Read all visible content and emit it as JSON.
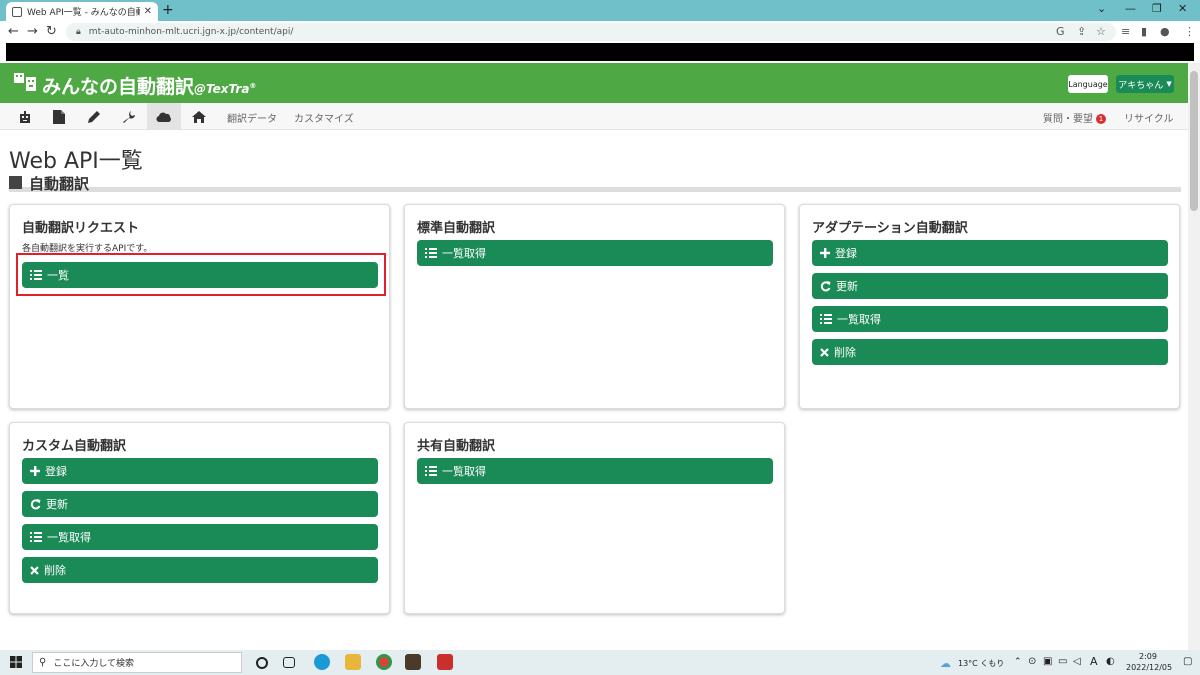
{
  "browser": {
    "tab_title": "Web API一覧 - みんなの自動翻訳@TexTra",
    "url": "mt-auto-minhon-mlt.ucri.jgn-x.jp/content/api/"
  },
  "header": {
    "logo_main": "みんなの自動翻訳",
    "logo_sub": "@TexTra",
    "logo_reg": "®",
    "language_label": "Language",
    "user_label": "アキちゃん"
  },
  "nav": {
    "link_data": "翻訳データ",
    "link_customize": "カスタマイズ",
    "link_requests": "質問・要望",
    "requests_badge": "1",
    "link_recycle": "リサイクル"
  },
  "page": {
    "title": "Web API一覧",
    "section_title": "自動翻訳"
  },
  "cards": {
    "request": {
      "title": "自動翻訳リクエスト",
      "desc": "各自動翻訳を実行するAPIです。",
      "btn_list": "一覧"
    },
    "standard": {
      "title": "標準自動翻訳",
      "btn_list": "一覧取得"
    },
    "adaptation": {
      "title": "アダプテーション自動翻訳",
      "btn_register": "登録",
      "btn_update": "更新",
      "btn_list": "一覧取得",
      "btn_delete": "削除"
    },
    "custom": {
      "title": "カスタム自動翻訳",
      "btn_register": "登録",
      "btn_update": "更新",
      "btn_list": "一覧取得",
      "btn_delete": "削除"
    },
    "shared": {
      "title": "共有自動翻訳",
      "btn_list": "一覧取得"
    }
  },
  "taskbar": {
    "search_placeholder": "ここに入力して検索",
    "weather": "13°C くもり",
    "ime": "A",
    "time": "2:09",
    "date": "2022/12/05"
  },
  "colors": {
    "header_green": "#4ea944",
    "button_green": "#1a8a57",
    "highlight_red": "#e0202a"
  }
}
